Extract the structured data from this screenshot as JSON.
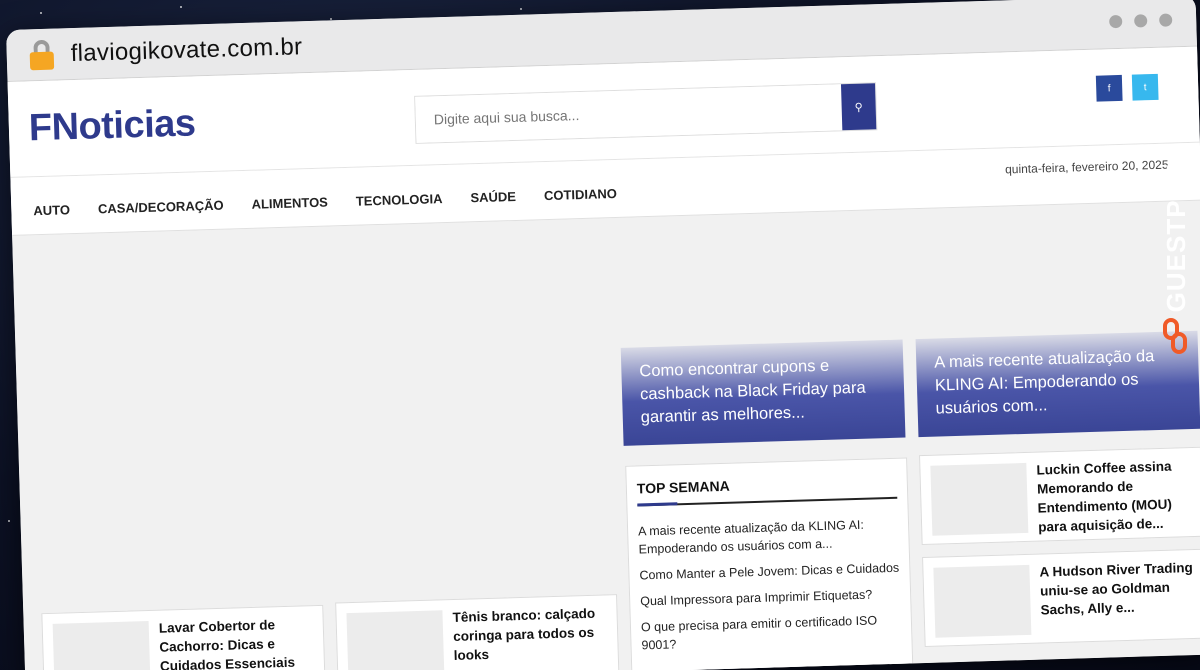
{
  "browser": {
    "url": "flaviogikovate.com.br"
  },
  "site": {
    "logo": "FNoticias",
    "search_placeholder": "Digite aqui sua busca...",
    "date": "quinta-feira, fevereiro 20, 2025"
  },
  "nav": {
    "items": [
      "AUTO",
      "CASA/DECORAÇÃO",
      "ALIMENTOS",
      "TECNOLOGIA",
      "SAÚDE",
      "COTIDIANO"
    ]
  },
  "hero": [
    {
      "title": "Como encontrar cupons e cashback na Black Friday para garantir as melhores..."
    },
    {
      "title": "A mais recente atualização da KLING AI: Empoderando os usuários com..."
    }
  ],
  "top_semana": {
    "heading": "TOP SEMANA",
    "items": [
      "A mais recente atualização da KLING AI: Empoderando os usuários com a...",
      "Como Manter a Pele Jovem: Dicas e Cuidados",
      "Qual Impressora para Imprimir Etiquetas?",
      "O que precisa para emitir o certificado ISO 9001?"
    ]
  },
  "side_cards": [
    {
      "title": "Luckin Coffee assina Memorando de Entendimento (MOU) para aquisição de..."
    },
    {
      "title": "A Hudson River Trading uniu-se ao Goldman Sachs, Ally e..."
    }
  ],
  "bottom_cards": [
    {
      "title": "Lavar Cobertor de Cachorro: Dicas e Cuidados Essenciais"
    },
    {
      "title": "Tênis branco: calçado coringa para todos os looks"
    }
  ],
  "badge": {
    "text": "GUESTPOSTLINKS",
    "accent": "#f05a28"
  },
  "colors": {
    "brand": "#2e3a8c",
    "twitter": "#37b8ee",
    "facebook": "#2a4a9c"
  }
}
